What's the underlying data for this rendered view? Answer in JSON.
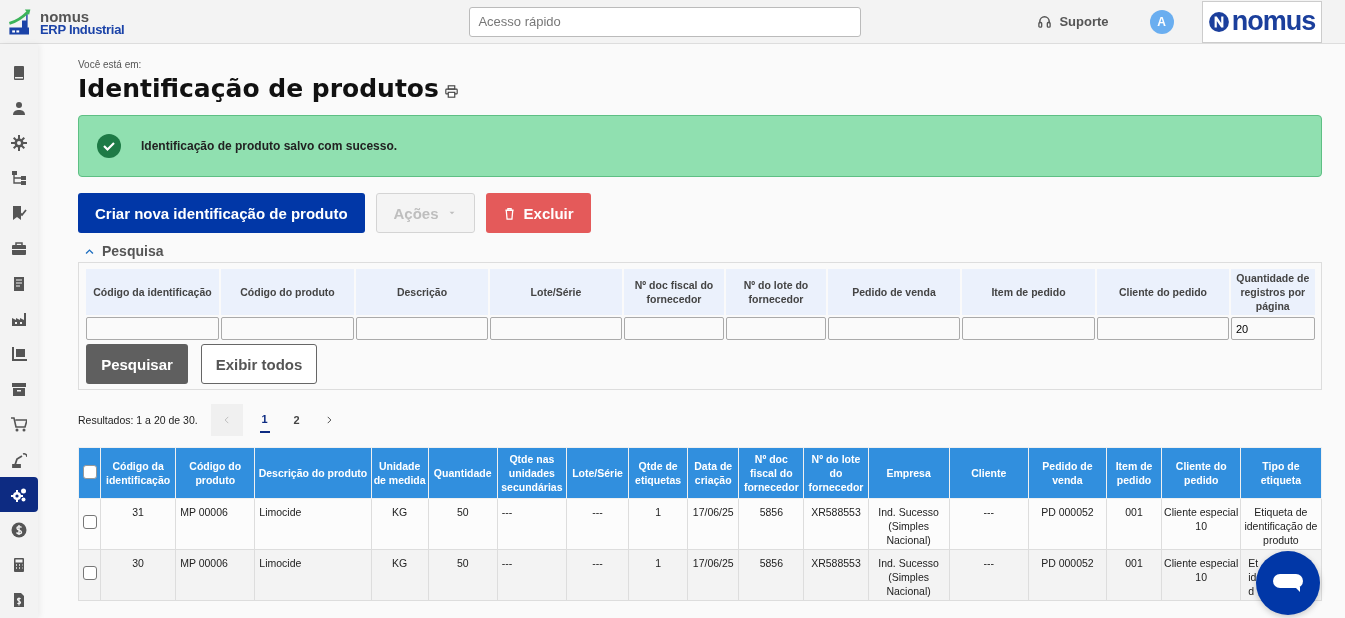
{
  "header": {
    "logo_brand": "nomus",
    "logo_product": "ERP Industrial",
    "quick_access": {
      "placeholder": "Acesso rápido"
    },
    "support": "Suporte",
    "avatar": "A",
    "brand_logo": "nomus"
  },
  "sidebar": {
    "items": [
      {
        "kind": "book",
        "selected": false
      },
      {
        "kind": "user",
        "selected": false
      },
      {
        "kind": "gear",
        "selected": false
      },
      {
        "kind": "hierarchy",
        "selected": false
      },
      {
        "kind": "bookmark",
        "selected": false
      },
      {
        "kind": "briefcase",
        "selected": false
      },
      {
        "kind": "document",
        "selected": false
      },
      {
        "kind": "factory",
        "selected": false
      },
      {
        "kind": "pallet",
        "selected": false
      },
      {
        "kind": "archive",
        "selected": false
      },
      {
        "kind": "cart",
        "selected": false
      },
      {
        "kind": "robot",
        "selected": false
      },
      {
        "kind": "gears",
        "selected": true
      },
      {
        "kind": "dollar",
        "selected": false
      },
      {
        "kind": "calculator",
        "selected": false
      },
      {
        "kind": "invoice",
        "selected": false
      }
    ]
  },
  "breadcrumb_label": "Você está em:",
  "title": "Identificação de produtos",
  "alert": {
    "kind": "success",
    "message": "Identificação de produto salvo com sucesso."
  },
  "buttons": [
    {
      "label": "Criar nova identificação de produto",
      "kind": "primary",
      "disabled": false
    },
    {
      "label": "Ações",
      "kind": "dropdown",
      "disabled": true
    },
    {
      "label": "Excluir",
      "kind": "danger",
      "disabled": false
    }
  ],
  "search": {
    "title": "Pesquisa",
    "expanded": true,
    "fields": [
      {
        "label": "Código da identificação"
      },
      {
        "label": "Código do produto"
      },
      {
        "label": "Descrição"
      },
      {
        "label": "Lote/Série"
      },
      {
        "label": "Nº doc fiscal do fornecedor"
      },
      {
        "label": "Nº do lote do fornecedor"
      },
      {
        "label": "Pedido de venda"
      },
      {
        "label": "Item de pedido"
      },
      {
        "label": "Cliente do pedido"
      },
      {
        "label": "Quantidade de registros por página",
        "value": "20"
      }
    ],
    "buttons": [
      {
        "label": "Pesquisar",
        "kind": "dark"
      },
      {
        "label": "Exibir todos",
        "kind": "outline"
      }
    ]
  },
  "results": {
    "summary": "Resultados: 1 a 20 de 30.",
    "pages": [
      {
        "label": "1",
        "selected": true
      },
      {
        "label": "2",
        "selected": false
      }
    ]
  },
  "table": {
    "select_all_checked": false,
    "columns": [
      "Código da identificação",
      "Código do produto",
      "Descrição do produto",
      "Unidade de medida",
      "Quantidade",
      "Qtde nas unidades secundárias",
      "Lote/Série",
      "Qtde de etiquetas",
      "Data de criação",
      "Nº doc fiscal do fornecedor",
      "Nº do lote do fornecedor",
      "Empresa",
      "Cliente",
      "Pedido de venda",
      "Item de pedido",
      "Cliente do pedido",
      "Tipo de etiqueta"
    ],
    "rows": [
      {
        "checked": false,
        "cells": [
          "31",
          "MP 00006",
          "Limocide",
          "KG",
          "50",
          "---",
          "---",
          "1",
          "17/06/25",
          "5856",
          "XR588553",
          "Ind. Sucesso (Simples Nacional)",
          "---",
          "PD 000052",
          "001",
          "Cliente especial 10",
          "Etiqueta de identificação de produto"
        ]
      },
      {
        "checked": false,
        "cells": [
          "30",
          "MP 00006",
          "Limocide",
          "KG",
          "50",
          "---",
          "---",
          "1",
          "17/06/25",
          "5856",
          "XR588553",
          "Ind. Sucesso (Simples Nacional)",
          "---",
          "PD 000052",
          "001",
          "Cliente especial 10",
          {
            "text": "Et\nid\nd",
            "covered": true
          }
        ]
      }
    ]
  }
}
